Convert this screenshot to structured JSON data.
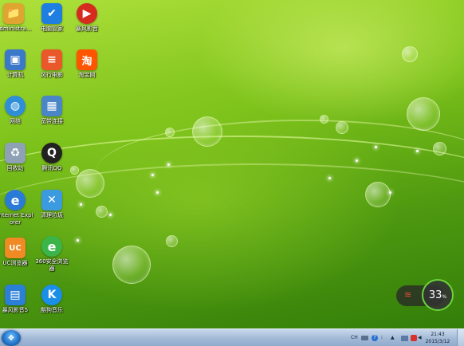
{
  "desktop": {
    "icons": [
      {
        "label": "Administra...",
        "icon": "user-folder-icon",
        "color": "#e0a530",
        "glyph": "📁"
      },
      {
        "label": "电脑管家",
        "icon": "shield-icon",
        "color": "#1e7fe0",
        "glyph": "✔"
      },
      {
        "label": "暴风影音",
        "icon": "play-icon",
        "color": "#d62b1f",
        "glyph": "▶"
      },
      {
        "label": "计算机",
        "icon": "computer-icon",
        "color": "#3a78c8",
        "glyph": "▣"
      },
      {
        "label": "风行电影",
        "icon": "windplay-icon",
        "color": "#e9572b",
        "glyph": "≡"
      },
      {
        "label": "淘宝网",
        "icon": "taobao-icon",
        "color": "#ff5500",
        "glyph": "淘"
      },
      {
        "label": "网络",
        "icon": "network-globe-icon",
        "color": "#2e8fd8",
        "glyph": "◍"
      },
      {
        "label": "宽带连接",
        "icon": "broadband-icon",
        "color": "#4a86c5",
        "glyph": "▦"
      },
      {
        "label": "回收站",
        "icon": "recycle-bin-icon",
        "color": "#8fa2b5",
        "glyph": "♻"
      },
      {
        "label": "腾讯QQ",
        "icon": "qq-penguin-icon",
        "color": "#222222",
        "glyph": "Q"
      },
      {
        "label": "Internet Explorer",
        "icon": "internet-explorer-icon",
        "color": "#2a7ad8",
        "glyph": "e"
      },
      {
        "label": "清理垃圾",
        "icon": "cleanup-trash-icon",
        "color": "#3b9ae0",
        "glyph": "✕"
      },
      {
        "label": "UC浏览器",
        "icon": "uc-browser-icon",
        "color": "#f08a24",
        "glyph": "UC"
      },
      {
        "label": "360安全浏览器",
        "icon": "360-browser-icon",
        "color": "#3bb54a",
        "glyph": "e"
      },
      {
        "label": "暴风影音5",
        "icon": "storm-player-icon",
        "color": "#2b7fd6",
        "glyph": "▤"
      },
      {
        "label": "酷狗音乐",
        "icon": "kugou-music-icon",
        "color": "#1a8fe8",
        "glyph": "K"
      }
    ]
  },
  "widget": {
    "speed_value": "33",
    "speed_unit": "%",
    "icon": "network-signal-icon"
  },
  "taskbar": {
    "start_icon": "windows-start-icon",
    "tray": {
      "lang": "CH",
      "keyboard_icon": "keyboard-icon",
      "help_icon": "help-icon",
      "ime_icon": "ime-icon",
      "arrow_icon": "tray-arrow-icon",
      "network_icon": "network-icon",
      "antivirus_icon": "antivirus-icon",
      "volume_icon": "volume-icon"
    },
    "clock_time": "21:43",
    "clock_date": "2015/3/12"
  }
}
